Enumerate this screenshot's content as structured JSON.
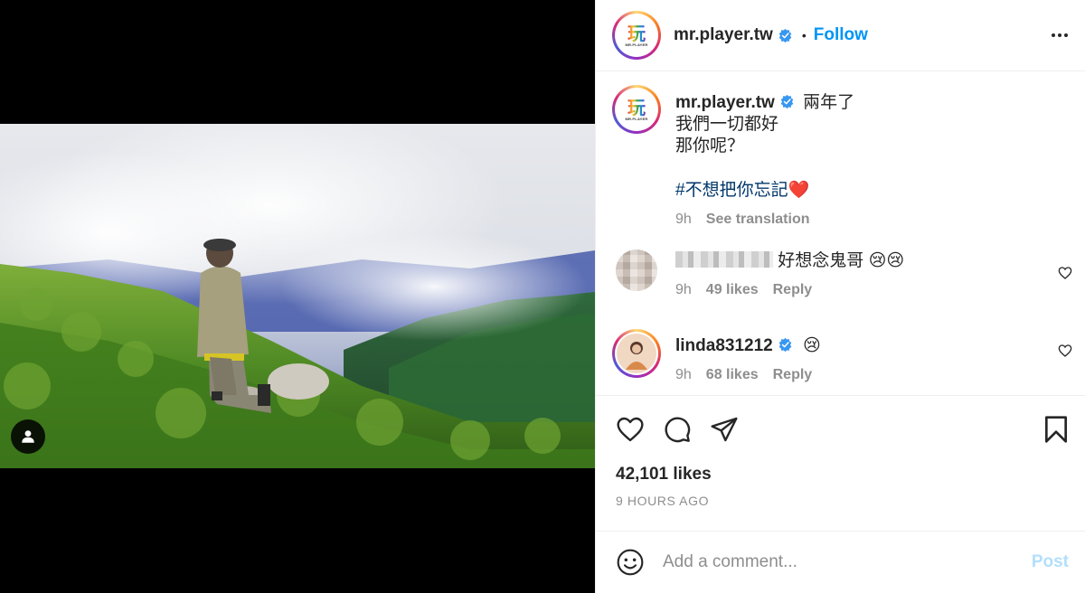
{
  "header": {
    "username": "mr.player.tw",
    "separator": "•",
    "follow_label": "Follow",
    "logo_text": "玩",
    "logo_sub": "MR.PLAYER"
  },
  "caption": {
    "username": "mr.player.tw",
    "lines": [
      "兩年了",
      "我們一切都好",
      "那你呢？"
    ],
    "hashtag": "#不想把你忘記",
    "emoji": "❤️",
    "time": "9h",
    "see_translation": "See translation"
  },
  "comments": [
    {
      "username_hidden": true,
      "text": "好想念鬼哥",
      "emoji": "😢😢",
      "time": "9h",
      "likes": "49 likes",
      "reply": "Reply"
    },
    {
      "username": "linda831212",
      "emoji": "😢",
      "time": "9h",
      "likes": "68 likes",
      "reply": "Reply"
    }
  ],
  "post": {
    "likes": "42,101 likes",
    "time_ago": "9 HOURS AGO"
  },
  "composer": {
    "placeholder": "Add a comment...",
    "post_label": "Post"
  },
  "icons": {
    "verified": "verified-badge-icon",
    "more": "more-options-icon",
    "like": "heart-icon",
    "comment": "comment-icon",
    "share": "share-icon",
    "save": "bookmark-icon",
    "emoji": "emoji-icon",
    "tag": "user-tag-icon"
  },
  "colors": {
    "accent": "#0095f6",
    "verified": "#3897f0",
    "hashtag": "#00376b",
    "muted": "#8e8e8e",
    "post_disabled": "#b2dffc"
  }
}
